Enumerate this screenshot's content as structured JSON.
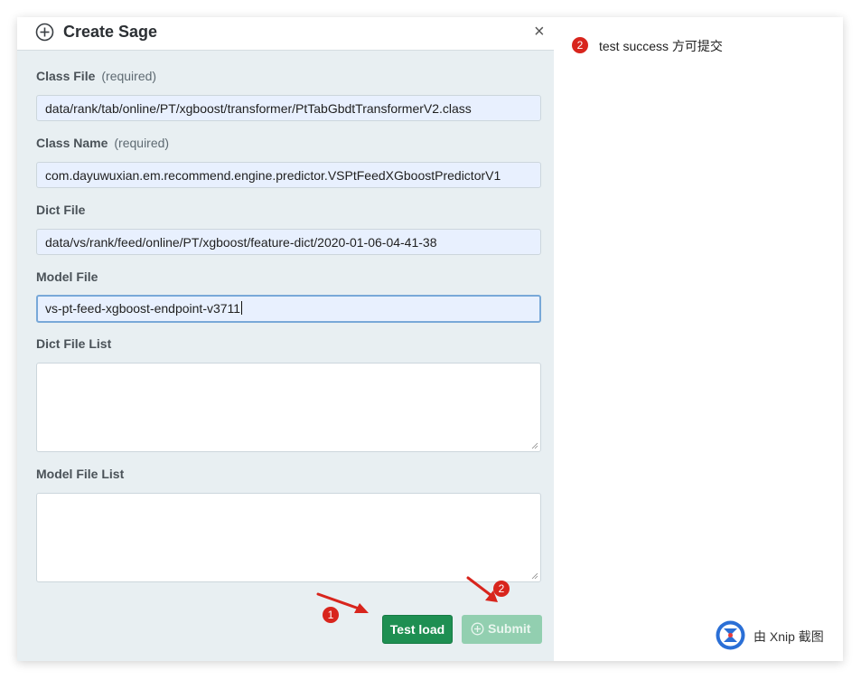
{
  "modal": {
    "title": "Create Sage",
    "close_label": "×"
  },
  "fields": {
    "class_file": {
      "label": "Class File",
      "required": "(required)",
      "value": "data/rank/tab/online/PT/xgboost/transformer/PtTabGbdtTransformerV2.class"
    },
    "class_name": {
      "label": "Class Name",
      "required": "(required)",
      "value": "com.dayuwuxian.em.recommend.engine.predictor.VSPtFeedXGboostPredictorV1"
    },
    "dict_file": {
      "label": "Dict File",
      "value": "data/vs/rank/feed/online/PT/xgboost/feature-dict/2020-01-06-04-41-38"
    },
    "model_file": {
      "label": "Model File",
      "value": "vs-pt-feed-xgboost-endpoint-v3711"
    },
    "dict_file_list": {
      "label": "Dict File List",
      "value": ""
    },
    "model_file_list": {
      "label": "Model File List",
      "value": ""
    }
  },
  "buttons": {
    "test_load": "Test load",
    "submit": "Submit"
  },
  "annotations": {
    "badge_1": "1",
    "badge_2": "2",
    "note_badge": "2",
    "note_text": "test success 方可提交",
    "badge_color": "#d8251d"
  },
  "watermark": {
    "text": "由 Xnip 截图"
  },
  "colors": {
    "modal_bg": "#e8eff2",
    "test_button": "#1e8f52",
    "submit_button_disabled": "#92cfb0",
    "input_bg": "#e8f0fe"
  }
}
